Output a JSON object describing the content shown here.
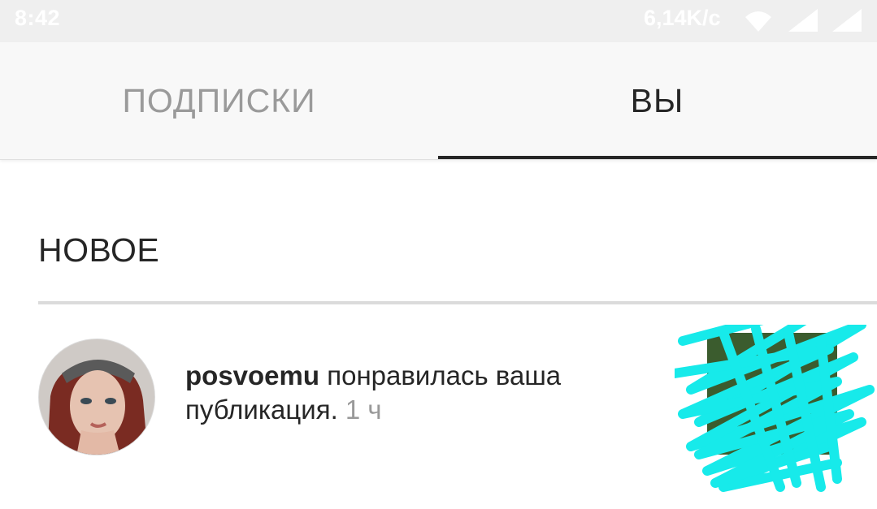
{
  "status_bar": {
    "time": "8:42",
    "network_speed": "6,14K/c",
    "icons": [
      "wifi-icon",
      "signal-icon",
      "signal-icon"
    ]
  },
  "tabs": [
    {
      "label": "ПОДПИСКИ",
      "active": false
    },
    {
      "label": "ВЫ",
      "active": true
    }
  ],
  "section": {
    "title": "НОВОЕ"
  },
  "notification": {
    "username": "posvoemu",
    "message": " понравилась ваша публикация. ",
    "time": "1 ч",
    "avatar_icon": "user-avatar",
    "thumbnail_icon": "post-thumbnail-scribbled"
  },
  "colors": {
    "text_primary": "#262626",
    "text_secondary": "#999999",
    "tab_inactive": "#9a9a9a",
    "status_bar_bg": "#efefef",
    "tab_bar_bg": "#f8f8f8",
    "scribble": "#17eaea"
  }
}
